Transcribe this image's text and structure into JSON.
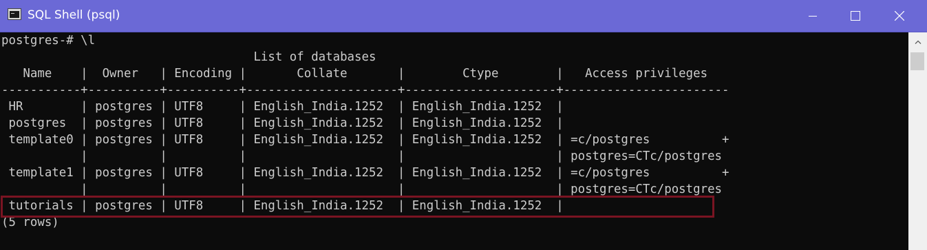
{
  "window": {
    "title": "SQL Shell (psql)"
  },
  "terminal": {
    "lines": [
      "postgres-# \\l",
      "                                   List of databases",
      "   Name    |  Owner   | Encoding |       Collate       |        Ctype        |   Access privileges",
      "-----------+----------+----------+---------------------+---------------------+-----------------------",
      " HR        | postgres | UTF8     | English_India.1252  | English_India.1252  |",
      " postgres  | postgres | UTF8     | English_India.1252  | English_India.1252  |",
      " template0 | postgres | UTF8     | English_India.1252  | English_India.1252  | =c/postgres          +",
      "           |          |          |                     |                     | postgres=CTc/postgres",
      " template1 | postgres | UTF8     | English_India.1252  | English_India.1252  | =c/postgres          +",
      "           |          |          |                     |                     | postgres=CTc/postgres",
      " tutorials | postgres | UTF8     | English_India.1252  | English_India.1252  |",
      "(5 rows)"
    ]
  },
  "colors": {
    "titlebar": "#6b69d6",
    "terminal_bg": "#0c0c0c",
    "terminal_text": "#cccccc",
    "highlight_border": "#7a1422",
    "scrollbar_bg": "#f0f0f0"
  },
  "icons": {
    "app": "console-window-icon",
    "minimize": "minimize-icon",
    "maximize": "maximize-icon",
    "close": "close-icon",
    "scroll_up": "chevron-up-icon"
  }
}
